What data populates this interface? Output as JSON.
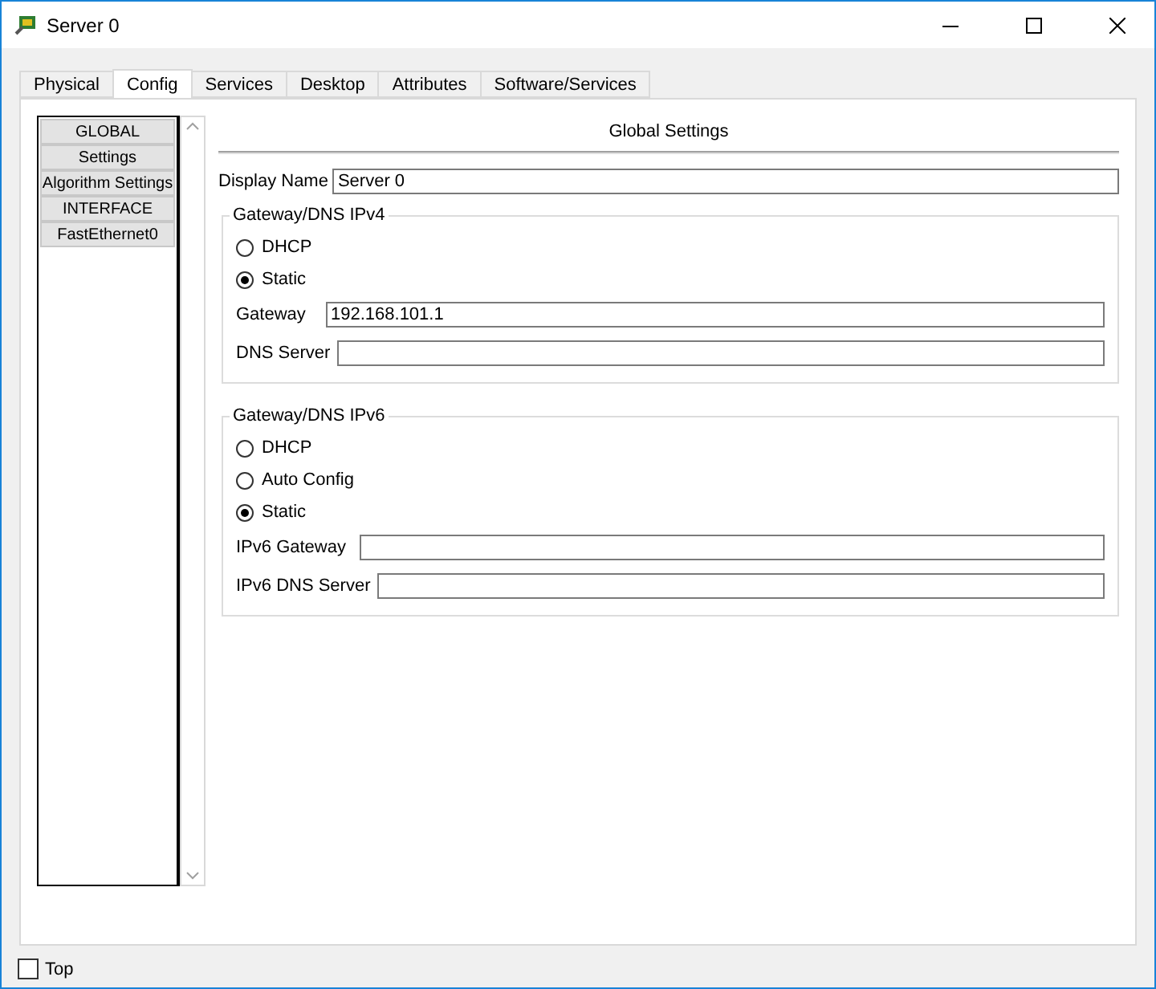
{
  "window": {
    "title": "Server 0"
  },
  "tabs": [
    {
      "label": "Physical",
      "selected": false
    },
    {
      "label": "Config",
      "selected": true
    },
    {
      "label": "Services",
      "selected": false
    },
    {
      "label": "Desktop",
      "selected": false
    },
    {
      "label": "Attributes",
      "selected": false
    },
    {
      "label": "Software/Services",
      "selected": false
    }
  ],
  "sidebar": {
    "items": [
      {
        "label": "GLOBAL"
      },
      {
        "label": "Settings"
      },
      {
        "label": "Algorithm Settings"
      },
      {
        "label": "INTERFACE"
      },
      {
        "label": "FastEthernet0"
      }
    ]
  },
  "settings": {
    "title": "Global Settings",
    "display_name": {
      "label": "Display Name",
      "value": "Server 0"
    },
    "groups": [
      {
        "title": "Gateway/DNS IPv4",
        "options": [
          {
            "label": "DHCP",
            "selected": false
          },
          {
            "label": "Static",
            "selected": true
          }
        ],
        "fields": [
          {
            "label": "Gateway",
            "value": "192.168.101.1"
          },
          {
            "label": "DNS Server"
          }
        ]
      },
      {
        "title": "Gateway/DNS IPv6",
        "options": [
          {
            "label": "DHCP",
            "selected": false
          },
          {
            "label": "Auto Config",
            "selected": false
          },
          {
            "label": "Static",
            "selected": true
          }
        ],
        "fields": [
          {
            "label": "IPv6 Gateway"
          },
          {
            "label": "IPv6 DNS Server"
          }
        ]
      }
    ]
  },
  "footer": {
    "top": {
      "label": "Top",
      "checked": false
    }
  }
}
